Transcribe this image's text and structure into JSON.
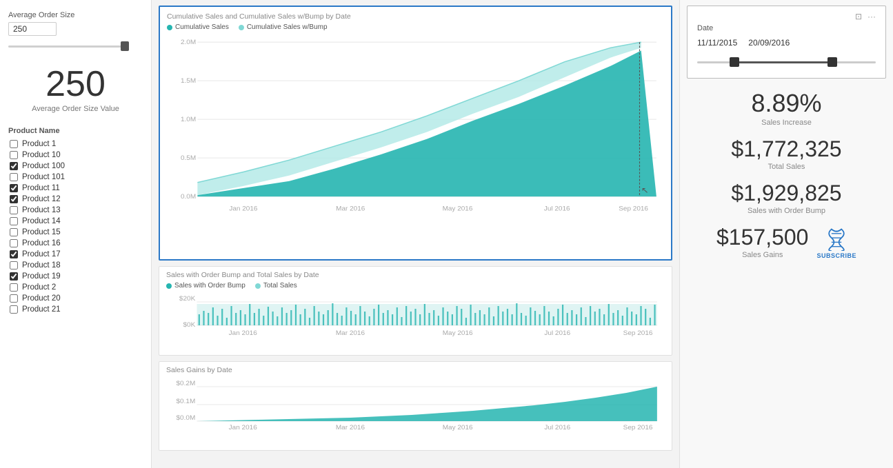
{
  "left": {
    "avgOrderLabel": "Average Order Size",
    "avgOrderInput": "250",
    "avgOrderBig": "250",
    "avgOrderSub": "Average Order Size Value",
    "productListHeader": "Product Name",
    "products": [
      {
        "name": "Product 1",
        "checked": false
      },
      {
        "name": "Product 10",
        "checked": false
      },
      {
        "name": "Product 100",
        "checked": true
      },
      {
        "name": "Product 101",
        "checked": false
      },
      {
        "name": "Product 11",
        "checked": true
      },
      {
        "name": "Product 12",
        "checked": true
      },
      {
        "name": "Product 13",
        "checked": false
      },
      {
        "name": "Product 14",
        "checked": false
      },
      {
        "name": "Product 15",
        "checked": false
      },
      {
        "name": "Product 16",
        "checked": false
      },
      {
        "name": "Product 17",
        "checked": true
      },
      {
        "name": "Product 18",
        "checked": false
      },
      {
        "name": "Product 19",
        "checked": true
      },
      {
        "name": "Product 2",
        "checked": false
      },
      {
        "name": "Product 20",
        "checked": false
      },
      {
        "name": "Product 21",
        "checked": false
      }
    ]
  },
  "topChart": {
    "title": "Cumulative Sales and Cumulative Sales w/Bump by Date",
    "legend1": "Cumulative Sales",
    "legend2": "Cumulative Sales w/Bump",
    "legend1Color": "#26b5b0",
    "legend2Color": "#80d8d5",
    "yLabels": [
      "2.0M",
      "1.5M",
      "1.0M",
      "0.5M",
      "0.0M"
    ],
    "xLabels": [
      "Jan 2016",
      "Mar 2016",
      "May 2016",
      "Jul 2016",
      "Sep 2016"
    ]
  },
  "middleChart": {
    "title": "Sales with Order Bump and Total Sales by Date",
    "legend1": "Sales with Order Bump",
    "legend2": "Total Sales",
    "legend1Color": "#26b5b0",
    "legend2Color": "#80d8d5",
    "yLabels": [
      "$20K",
      "$0K"
    ],
    "xLabels": [
      "Jan 2016",
      "Mar 2016",
      "May 2016",
      "Jul 2016",
      "Sep 2016"
    ]
  },
  "bottomChart": {
    "title": "Sales Gains by Date",
    "yLabels": [
      "$0.2M",
      "$0.1M",
      "$0.0M"
    ],
    "xLabels": [
      "Jan 2016",
      "Mar 2016",
      "May 2016",
      "Jul 2016",
      "Sep 2016"
    ]
  },
  "right": {
    "dateLabel": "Date",
    "dateStart": "11/11/2015",
    "dateEnd": "20/09/2016",
    "kpis": [
      {
        "value": "8.89%",
        "label": "Sales Increase"
      },
      {
        "value": "$1,772,325",
        "label": "Total Sales"
      },
      {
        "value": "$1,929,825",
        "label": "Sales with Order Bump"
      },
      {
        "value": "$157,500",
        "label": "Sales Gains"
      }
    ],
    "subscribeLabel": "SUBSCRIBE"
  }
}
